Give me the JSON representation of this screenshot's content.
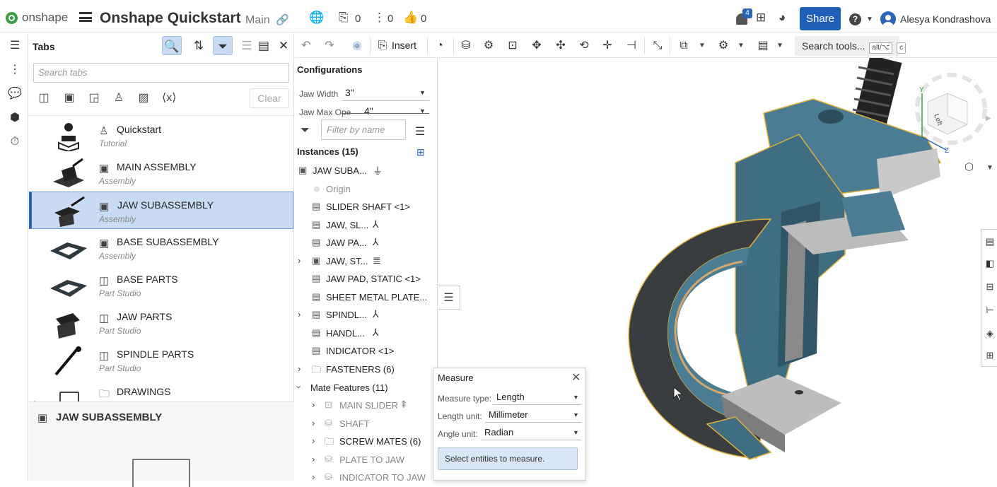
{
  "header": {
    "logo_text": "onshape",
    "doc_title": "Onshape Quickstart",
    "branch": "Main",
    "versions_count": "0",
    "comments_count": "0",
    "likes_count": "0",
    "notifications_count": "4",
    "share_label": "Share",
    "user_name": "Alesya Kondrashova"
  },
  "tabs_panel": {
    "title": "Tabs",
    "search_placeholder": "Search tabs",
    "clear_label": "Clear",
    "items": [
      {
        "name": "Quickstart",
        "kind": "Tutorial"
      },
      {
        "name": "MAIN ASSEMBLY",
        "kind": "Assembly"
      },
      {
        "name": "JAW SUBASSEMBLY",
        "kind": "Assembly",
        "active": true
      },
      {
        "name": "BASE SUBASSEMBLY",
        "kind": "Assembly"
      },
      {
        "name": "BASE PARTS",
        "kind": "Part Studio"
      },
      {
        "name": "JAW PARTS",
        "kind": "Part Studio"
      },
      {
        "name": "SPINDLE PARTS",
        "kind": "Part Studio"
      },
      {
        "name": "DRAWINGS",
        "kind": ""
      }
    ],
    "selected_label": "JAW SUBASSEMBLY"
  },
  "toolbar": {
    "insert_label": "Insert",
    "search_tools_label": "Search tools...",
    "search_tools_shortcut_1": "alt/⌥",
    "search_tools_shortcut_2": "c"
  },
  "instances_panel": {
    "config_title": "Configurations",
    "configs": [
      {
        "label": "Jaw Width",
        "value": "3\""
      },
      {
        "label": "Jaw Max Ope",
        "value": "4\""
      }
    ],
    "filter_placeholder": "Filter by name",
    "instances_title": "Instances (15)",
    "tree": [
      {
        "label": "JAW SUBA...",
        "indent": 0,
        "caret": false,
        "muted": false
      },
      {
        "label": "Origin",
        "indent": 1,
        "caret": false,
        "muted": true
      },
      {
        "label": "SLIDER SHAFT <1>",
        "indent": 1,
        "caret": false,
        "muted": false
      },
      {
        "label": "JAW, SL...",
        "indent": 1,
        "caret": false,
        "muted": false
      },
      {
        "label": "JAW PA...",
        "indent": 1,
        "caret": false,
        "muted": false
      },
      {
        "label": "JAW, ST...",
        "indent": 1,
        "caret": true,
        "muted": false
      },
      {
        "label": "JAW PAD, STATIC <1>",
        "indent": 1,
        "caret": false,
        "muted": false
      },
      {
        "label": "SHEET METAL PLATE...",
        "indent": 1,
        "caret": false,
        "muted": false
      },
      {
        "label": "SPINDL...",
        "indent": 1,
        "caret": true,
        "muted": false
      },
      {
        "label": "HANDL...",
        "indent": 1,
        "caret": false,
        "muted": false
      },
      {
        "label": "INDICATOR <1>",
        "indent": 1,
        "caret": false,
        "muted": false
      },
      {
        "label": "FASTENERS (6)",
        "indent": 1,
        "caret": true,
        "muted": false
      },
      {
        "label": "Mate Features (11)",
        "indent": 0,
        "caret": true,
        "muted": false
      },
      {
        "label": "MAIN SLIDER",
        "indent": 2,
        "caret": true,
        "muted": true
      },
      {
        "label": "SHAFT",
        "indent": 2,
        "caret": true,
        "muted": true
      },
      {
        "label": "SCREW MATES (6)",
        "indent": 2,
        "caret": true,
        "muted": false
      },
      {
        "label": "PLATE TO JAW",
        "indent": 2,
        "caret": true,
        "muted": true
      },
      {
        "label": "INDICATOR TO JAW",
        "indent": 2,
        "caret": true,
        "muted": true
      }
    ]
  },
  "viewcube": {
    "face_label": "Left",
    "axis_y": "Y",
    "axis_z": "Z"
  },
  "measure": {
    "title": "Measure",
    "type_label": "Measure type:",
    "type_value": "Length",
    "length_unit_label": "Length unit:",
    "length_unit_value": "Millimeter",
    "angle_unit_label": "Angle unit:",
    "angle_unit_value": "Radian",
    "info": "Select entities to measure."
  },
  "colors": {
    "accent": "#2a63b8",
    "share": "#1f5fb9",
    "active_tab": "#c9dbf3",
    "part_blue": "#3f6d82"
  }
}
